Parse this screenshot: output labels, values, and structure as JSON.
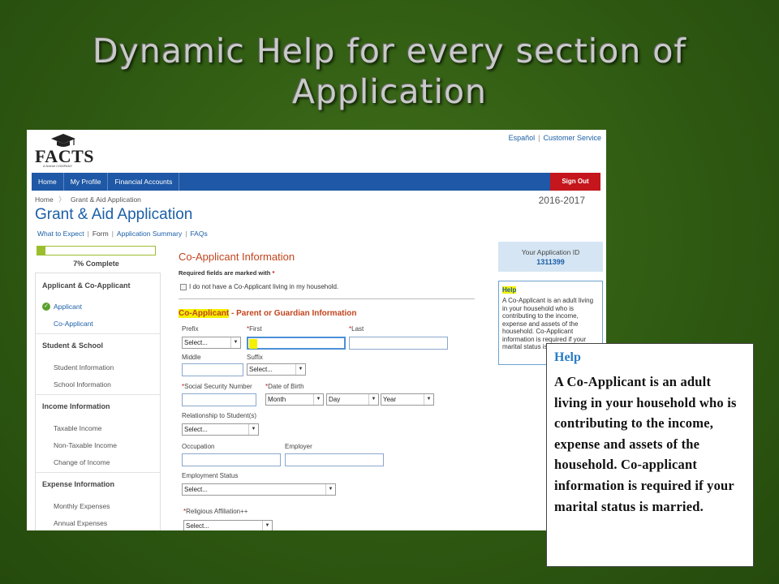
{
  "slide": {
    "title_line1": "Dynamic Help for every section of",
    "title_line2": "Application"
  },
  "app": {
    "logo_text": "FACTS",
    "logo_tagline": "A Nelnet COMPANY",
    "top_links": [
      "Español",
      "Customer Service"
    ],
    "nav": {
      "items": [
        "Home",
        "My Profile",
        "Financial Accounts"
      ],
      "sign_out": "Sign Out"
    },
    "breadcrumb": [
      "Home",
      "Grant & Aid Application"
    ],
    "year": "2016-2017",
    "page_title": "Grant & Aid Application",
    "subnav": [
      "What to Expect",
      "Form",
      "Application Summary",
      "FAQs"
    ],
    "progress": {
      "percent": 7,
      "label": "7% Complete"
    },
    "sidebar": {
      "groups": [
        {
          "heading": "Applicant & Co-Applicant",
          "items": [
            "Applicant",
            "Co-Applicant"
          ]
        },
        {
          "heading": "Student & School",
          "items": [
            "Student Information",
            "School Information"
          ]
        },
        {
          "heading": "Income Information",
          "items": [
            "Taxable Income",
            "Non-Taxable Income",
            "Change of Income"
          ]
        },
        {
          "heading": "Expense Information",
          "items": [
            "Monthly Expenses",
            "Annual Expenses"
          ]
        }
      ]
    },
    "form": {
      "section_title": "Co-Applicant Information",
      "required_note": "Required fields are marked with",
      "required_star": "*",
      "no_coapp_label": "I do not have a Co-Applicant living in my household.",
      "subsection_highlight": "Co-Applicant",
      "subsection_rest": " - Parent or Guardian Information",
      "labels": {
        "prefix": "Prefix",
        "first": "First",
        "last": "Last",
        "middle": "Middle",
        "suffix": "Suffix",
        "ssn": "Social Security Number",
        "dob": "Date of Birth",
        "relationship": "Relationship to Student(s)",
        "occupation": "Occupation",
        "employer": "Employer",
        "employment_status": "Employment Status",
        "religious": "Religious Affiliation++"
      },
      "selects": {
        "prefix": "Select...",
        "suffix": "Select...",
        "month": "Month",
        "day": "Day",
        "year": "Year",
        "relationship": "Select...",
        "employment_status": "Select...",
        "religious": "Select..."
      }
    },
    "app_id": {
      "label": "Your Application ID",
      "value": "1311399"
    },
    "help_panel": {
      "title": "Help",
      "text": "A Co-Applicant is an adult living in your household who is contributing to the income, expense and assets of the household. Co-Applicant information is required if your marital status is"
    }
  },
  "callout": {
    "title": "Help",
    "body": "A Co-Applicant is an adult living in your household who is contributing to the income, expense and assets of the household. Co-applicant information is required if your marital status is married."
  }
}
